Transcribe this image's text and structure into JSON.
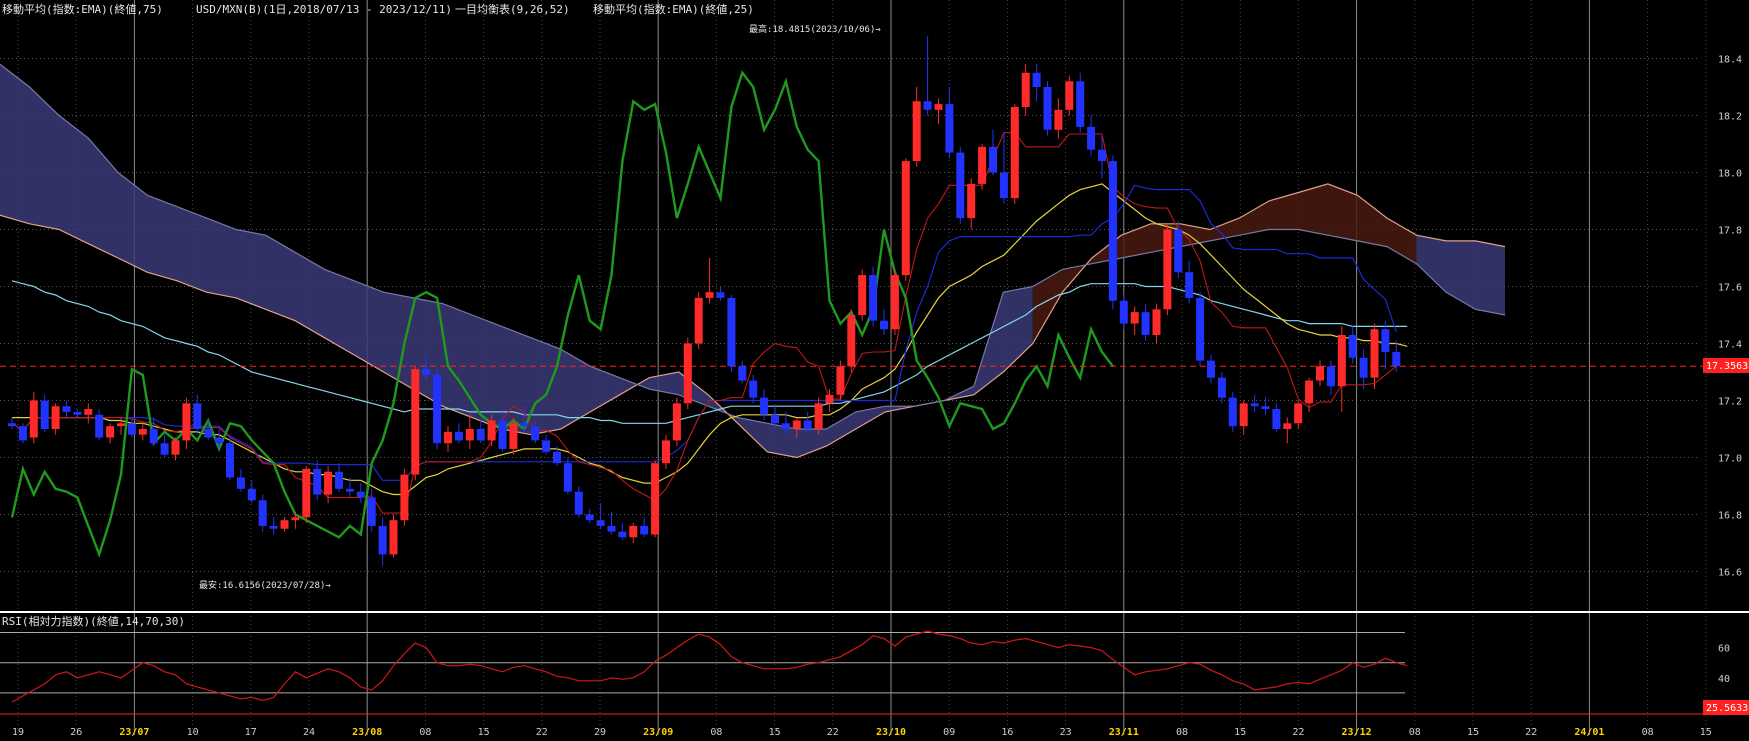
{
  "header": {
    "ema75": "移動平均(指数:EMA)(終値,75)",
    "pair": "USD/MXN(B)(1日,2018/07/13 - 2023/12/11)",
    "ichimoku": "一目均衡表(9,26,52)",
    "ema25": "移動平均(指数:EMA)(終値,25)"
  },
  "annotations": {
    "high": "最高:18.4815(2023/10/06)→",
    "low": "最安:16.6156(2023/07/28)→"
  },
  "rsi_header": "RSI(相対力指数)(終値,14,70,30)",
  "badges": {
    "price": "17.3563",
    "rsi": "25.5633"
  },
  "colors": {
    "up": "#ff2a2a",
    "down": "#2233ff",
    "ema25": "#e6d23a",
    "ema75": "#86d6ea",
    "kijun": "#1a2bd6",
    "tenkan": "#c01818",
    "chikou": "#1e9a1e",
    "cloud_bear": "#3a3a78",
    "cloud_bull": "#4a1a10",
    "rsi": "#d01818"
  },
  "chart_data": [
    {
      "type": "line",
      "ylim": [
        16.5,
        18.5
      ],
      "yticks": [
        "18.4",
        "18.2",
        "18.0",
        "17.8",
        "17.6",
        "17.4",
        "17.2",
        "17.0",
        "16.8",
        "16.6"
      ],
      "xticks": [
        "19",
        "26",
        "23/07",
        "10",
        "17",
        "24",
        "23/08",
        "08",
        "15",
        "22",
        "29",
        "23/09",
        "08",
        "15",
        "22",
        "23/10",
        "09",
        "16",
        "23",
        "23/11",
        "08",
        "15",
        "22",
        "23/12",
        "08",
        "15",
        "22",
        "24/01",
        "08",
        "15"
      ],
      "candles": [
        [
          17.12,
          17.14,
          17.1,
          17.11
        ],
        [
          17.11,
          17.12,
          17.05,
          17.06
        ],
        [
          17.07,
          17.23,
          17.05,
          17.2
        ],
        [
          17.2,
          17.22,
          17.09,
          17.1
        ],
        [
          17.1,
          17.19,
          17.08,
          17.18
        ],
        [
          17.18,
          17.2,
          17.14,
          17.16
        ],
        [
          17.16,
          17.17,
          17.14,
          17.15
        ],
        [
          17.15,
          17.19,
          17.12,
          17.17
        ],
        [
          17.15,
          17.17,
          17.06,
          17.07
        ],
        [
          17.07,
          17.12,
          17.05,
          17.11
        ],
        [
          17.11,
          17.14,
          17.08,
          17.12
        ],
        [
          17.12,
          17.14,
          17.07,
          17.08
        ],
        [
          17.08,
          17.12,
          17.06,
          17.1
        ],
        [
          17.1,
          17.14,
          17.04,
          17.05
        ],
        [
          17.05,
          17.08,
          17.0,
          17.01
        ],
        [
          17.01,
          17.07,
          16.99,
          17.06
        ],
        [
          17.06,
          17.21,
          17.03,
          17.19
        ],
        [
          17.19,
          17.22,
          17.08,
          17.1
        ],
        [
          17.1,
          17.13,
          17.06,
          17.07
        ],
        [
          17.07,
          17.1,
          17.03,
          17.05
        ],
        [
          17.05,
          17.07,
          16.92,
          16.93
        ],
        [
          16.93,
          16.96,
          16.88,
          16.89
        ],
        [
          16.89,
          16.92,
          16.84,
          16.85
        ],
        [
          16.85,
          16.87,
          16.74,
          16.76
        ],
        [
          16.76,
          16.79,
          16.73,
          16.75
        ],
        [
          16.75,
          16.79,
          16.74,
          16.78
        ],
        [
          16.78,
          16.81,
          16.75,
          16.79
        ],
        [
          16.79,
          16.97,
          16.77,
          16.96
        ],
        [
          16.96,
          16.99,
          16.85,
          16.87
        ],
        [
          16.87,
          16.97,
          16.84,
          16.95
        ],
        [
          16.95,
          16.98,
          16.88,
          16.89
        ],
        [
          16.89,
          16.93,
          16.86,
          16.88
        ],
        [
          16.88,
          16.91,
          16.84,
          16.86
        ],
        [
          16.86,
          16.89,
          16.74,
          16.76
        ],
        [
          16.76,
          16.79,
          16.62,
          16.66
        ],
        [
          16.66,
          16.8,
          16.65,
          16.78
        ],
        [
          16.78,
          16.96,
          16.76,
          16.94
        ],
        [
          16.94,
          17.32,
          16.92,
          17.31
        ],
        [
          17.31,
          17.35,
          17.27,
          17.29
        ],
        [
          17.29,
          17.31,
          17.03,
          17.05
        ],
        [
          17.05,
          17.11,
          17.02,
          17.09
        ],
        [
          17.09,
          17.12,
          17.05,
          17.06
        ],
        [
          17.06,
          17.15,
          17.03,
          17.1
        ],
        [
          17.1,
          17.13,
          17.05,
          17.06
        ],
        [
          17.06,
          17.15,
          17.04,
          17.13
        ],
        [
          17.13,
          17.16,
          17.02,
          17.03
        ],
        [
          17.03,
          17.14,
          17.01,
          17.12
        ],
        [
          17.12,
          17.18,
          17.09,
          17.11
        ],
        [
          17.11,
          17.13,
          17.05,
          17.06
        ],
        [
          17.06,
          17.08,
          17.01,
          17.02
        ],
        [
          17.02,
          17.04,
          16.97,
          16.98
        ],
        [
          16.98,
          17.0,
          16.87,
          16.88
        ],
        [
          16.88,
          16.9,
          16.79,
          16.8
        ],
        [
          16.8,
          16.82,
          16.77,
          16.78
        ],
        [
          16.78,
          16.84,
          16.75,
          16.76
        ],
        [
          16.76,
          16.81,
          16.73,
          16.74
        ],
        [
          16.74,
          16.77,
          16.71,
          16.72
        ],
        [
          16.72,
          16.77,
          16.7,
          16.76
        ],
        [
          16.76,
          16.79,
          16.72,
          16.73
        ],
        [
          16.73,
          16.99,
          16.72,
          16.98
        ],
        [
          16.98,
          17.08,
          16.96,
          17.06
        ],
        [
          17.06,
          17.21,
          17.04,
          17.19
        ],
        [
          17.19,
          17.42,
          17.17,
          17.4
        ],
        [
          17.4,
          17.58,
          17.38,
          17.56
        ],
        [
          17.56,
          17.7,
          17.54,
          17.58
        ],
        [
          17.58,
          17.6,
          17.55,
          17.56
        ],
        [
          17.56,
          17.57,
          17.3,
          17.32
        ],
        [
          17.32,
          17.34,
          17.26,
          17.27
        ],
        [
          17.27,
          17.29,
          17.19,
          17.21
        ],
        [
          17.21,
          17.24,
          17.13,
          17.15
        ],
        [
          17.15,
          17.18,
          17.1,
          17.12
        ],
        [
          17.12,
          17.16,
          17.08,
          17.1
        ],
        [
          17.1,
          17.14,
          17.07,
          17.13
        ],
        [
          17.13,
          17.16,
          17.09,
          17.1
        ],
        [
          17.1,
          17.21,
          17.08,
          17.19
        ],
        [
          17.19,
          17.24,
          17.16,
          17.22
        ],
        [
          17.22,
          17.34,
          17.2,
          17.32
        ],
        [
          17.32,
          17.52,
          17.3,
          17.5
        ],
        [
          17.5,
          17.66,
          17.48,
          17.64
        ],
        [
          17.64,
          17.67,
          17.46,
          17.48
        ],
        [
          17.48,
          17.52,
          17.43,
          17.45
        ],
        [
          17.45,
          17.66,
          17.43,
          17.64
        ],
        [
          17.64,
          18.05,
          17.62,
          18.04
        ],
        [
          18.04,
          18.3,
          18.02,
          18.25
        ],
        [
          18.25,
          18.48,
          18.2,
          18.22
        ],
        [
          18.22,
          18.26,
          18.17,
          18.24
        ],
        [
          18.24,
          18.3,
          18.05,
          18.07
        ],
        [
          18.07,
          18.09,
          17.82,
          17.84
        ],
        [
          17.84,
          17.98,
          17.8,
          17.96
        ],
        [
          17.96,
          18.1,
          17.94,
          18.09
        ],
        [
          18.09,
          18.15,
          17.99,
          18.0
        ],
        [
          18.0,
          18.14,
          17.89,
          17.91
        ],
        [
          17.91,
          18.24,
          17.89,
          18.23
        ],
        [
          18.23,
          18.38,
          18.2,
          18.35
        ],
        [
          18.35,
          18.38,
          18.25,
          18.3
        ],
        [
          18.3,
          18.32,
          18.13,
          18.15
        ],
        [
          18.15,
          18.26,
          18.12,
          18.22
        ],
        [
          18.22,
          18.34,
          18.2,
          18.32
        ],
        [
          18.32,
          18.35,
          18.14,
          18.16
        ],
        [
          18.16,
          18.2,
          18.06,
          18.08
        ],
        [
          18.08,
          18.13,
          17.98,
          18.04
        ],
        [
          18.04,
          18.06,
          17.52,
          17.55
        ],
        [
          17.55,
          17.57,
          17.45,
          17.47
        ],
        [
          17.47,
          17.53,
          17.43,
          17.51
        ],
        [
          17.51,
          17.54,
          17.41,
          17.43
        ],
        [
          17.43,
          17.54,
          17.4,
          17.52
        ],
        [
          17.52,
          17.82,
          17.5,
          17.8
        ],
        [
          17.8,
          17.83,
          17.63,
          17.65
        ],
        [
          17.65,
          17.69,
          17.54,
          17.56
        ],
        [
          17.56,
          17.58,
          17.32,
          17.34
        ],
        [
          17.34,
          17.36,
          17.26,
          17.28
        ],
        [
          17.28,
          17.3,
          17.19,
          17.21
        ],
        [
          17.21,
          17.23,
          17.09,
          17.11
        ],
        [
          17.11,
          17.2,
          17.08,
          17.19
        ],
        [
          17.19,
          17.22,
          17.16,
          17.18
        ],
        [
          17.18,
          17.21,
          17.15,
          17.17
        ],
        [
          17.17,
          17.19,
          17.09,
          17.1
        ],
        [
          17.1,
          17.14,
          17.05,
          17.12
        ],
        [
          17.12,
          17.2,
          17.1,
          17.19
        ],
        [
          17.19,
          17.28,
          17.16,
          17.27
        ],
        [
          17.27,
          17.34,
          17.25,
          17.32
        ],
        [
          17.32,
          17.34,
          17.22,
          17.25
        ],
        [
          17.25,
          17.46,
          17.16,
          17.43
        ],
        [
          17.43,
          17.46,
          17.33,
          17.35
        ],
        [
          17.35,
          17.38,
          17.24,
          17.28
        ],
        [
          17.28,
          17.47,
          17.24,
          17.45
        ],
        [
          17.45,
          17.48,
          17.31,
          17.37
        ],
        [
          17.37,
          17.41,
          17.3,
          17.32
        ]
      ],
      "ema25": [
        17.14,
        17.14,
        17.14,
        17.14,
        17.14,
        17.14,
        17.14,
        17.14,
        17.14,
        17.13,
        17.13,
        17.12,
        17.12,
        17.11,
        17.1,
        17.09,
        17.09,
        17.09,
        17.08,
        17.08,
        17.06,
        17.04,
        17.02,
        17.0,
        16.98,
        16.96,
        16.95,
        16.95,
        16.94,
        16.94,
        16.93,
        16.92,
        16.92,
        16.9,
        16.88,
        16.87,
        16.87,
        16.9,
        16.93,
        16.94,
        16.96,
        16.97,
        16.98,
        16.99,
        17.0,
        17.01,
        17.02,
        17.03,
        17.03,
        17.03,
        17.03,
        17.02,
        17.0,
        16.98,
        16.97,
        16.95,
        16.93,
        16.92,
        16.91,
        16.91,
        16.93,
        16.95,
        16.98,
        17.03,
        17.08,
        17.12,
        17.14,
        17.15,
        17.15,
        17.15,
        17.15,
        17.15,
        17.14,
        17.14,
        17.15,
        17.15,
        17.17,
        17.2,
        17.24,
        17.26,
        17.28,
        17.31,
        17.37,
        17.44,
        17.5,
        17.56,
        17.6,
        17.62,
        17.64,
        17.67,
        17.69,
        17.71,
        17.75,
        17.79,
        17.83,
        17.86,
        17.89,
        17.92,
        17.94,
        17.95,
        17.96,
        17.93,
        17.9,
        17.87,
        17.84,
        17.82,
        17.81,
        17.8,
        17.78,
        17.75,
        17.71,
        17.67,
        17.63,
        17.59,
        17.56,
        17.53,
        17.5,
        17.47,
        17.45,
        17.44,
        17.43,
        17.43,
        17.42,
        17.42,
        17.41,
        17.41,
        17.4,
        17.4,
        17.39
      ],
      "ema75": [
        17.62,
        17.61,
        17.6,
        17.58,
        17.57,
        17.55,
        17.54,
        17.53,
        17.51,
        17.5,
        17.48,
        17.47,
        17.46,
        17.44,
        17.42,
        17.41,
        17.4,
        17.39,
        17.37,
        17.36,
        17.34,
        17.32,
        17.3,
        17.29,
        17.28,
        17.27,
        17.26,
        17.25,
        17.24,
        17.23,
        17.22,
        17.21,
        17.2,
        17.19,
        17.18,
        17.17,
        17.16,
        17.17,
        17.17,
        17.17,
        17.17,
        17.17,
        17.16,
        17.16,
        17.16,
        17.16,
        17.16,
        17.15,
        17.15,
        17.15,
        17.15,
        17.14,
        17.14,
        17.14,
        17.13,
        17.13,
        17.12,
        17.12,
        17.12,
        17.12,
        17.12,
        17.13,
        17.14,
        17.15,
        17.16,
        17.17,
        17.18,
        17.18,
        17.18,
        17.18,
        17.18,
        17.18,
        17.18,
        17.18,
        17.18,
        17.19,
        17.19,
        17.2,
        17.21,
        17.22,
        17.23,
        17.25,
        17.27,
        17.29,
        17.32,
        17.34,
        17.36,
        17.38,
        17.4,
        17.42,
        17.44,
        17.46,
        17.48,
        17.5,
        17.53,
        17.55,
        17.57,
        17.58,
        17.6,
        17.61,
        17.61,
        17.61,
        17.61,
        17.61,
        17.6,
        17.6,
        17.6,
        17.59,
        17.58,
        17.57,
        17.55,
        17.54,
        17.53,
        17.52,
        17.51,
        17.5,
        17.49,
        17.48,
        17.48,
        17.47,
        17.47,
        17.47,
        17.47,
        17.46,
        17.46,
        17.46,
        17.46,
        17.46,
        17.46
      ],
      "rsi_ylim": [
        20,
        75
      ],
      "rsi_levels": [
        70,
        30
      ],
      "rsi_ticks": [
        "60",
        "40"
      ],
      "rsi": [
        24,
        28,
        32,
        36,
        42,
        44,
        40,
        42,
        44,
        42,
        40,
        45,
        50,
        48,
        44,
        42,
        36,
        34,
        32,
        30,
        28,
        26,
        27,
        25,
        27,
        36,
        44,
        40,
        43,
        46,
        44,
        40,
        34,
        32,
        38,
        48,
        56,
        63,
        60,
        50,
        48,
        48,
        49,
        48,
        46,
        44,
        47,
        48,
        46,
        44,
        41,
        40,
        38,
        38,
        38,
        40,
        39,
        40,
        44,
        51,
        55,
        60,
        65,
        69,
        67,
        62,
        54,
        50,
        48,
        46,
        46,
        46,
        47,
        49,
        50,
        52,
        54,
        58,
        62,
        68,
        66,
        61,
        67,
        69,
        71,
        69,
        68,
        66,
        63,
        62,
        64,
        63,
        65,
        66,
        64,
        62,
        60,
        62,
        61,
        60,
        58,
        52,
        47,
        42,
        44,
        45,
        46,
        48,
        50,
        49,
        45,
        42,
        38,
        36,
        32,
        33,
        34,
        36,
        37,
        36,
        39,
        42,
        45,
        50,
        47,
        49,
        53,
        50,
        48
      ]
    }
  ]
}
